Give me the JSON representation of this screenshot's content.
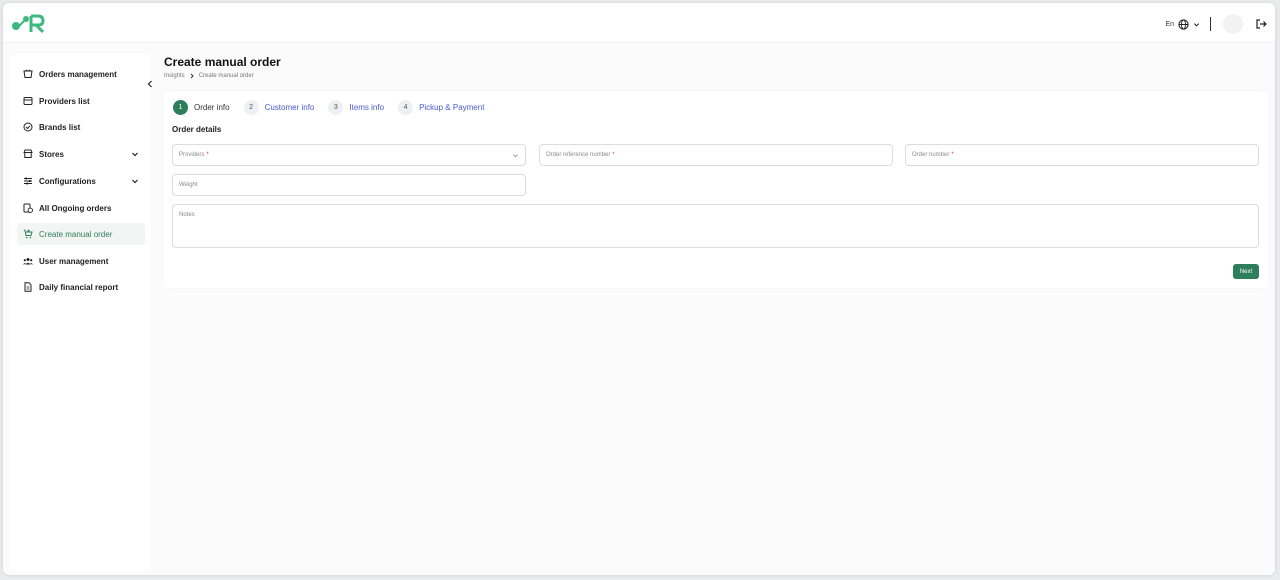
{
  "brand": {
    "accent": "#2e7d5b",
    "logo_color": "#3cb97f"
  },
  "header": {
    "language": "En",
    "icons": [
      "globe-icon",
      "chevron-down-icon",
      "logout-icon"
    ]
  },
  "sidebar": {
    "items": [
      {
        "label": "Orders management",
        "icon": "basket-icon",
        "has_submenu": false,
        "active": false
      },
      {
        "label": "Providers list",
        "icon": "store-icon",
        "has_submenu": false,
        "active": false
      },
      {
        "label": "Brands list",
        "icon": "badge-check-icon",
        "has_submenu": false,
        "active": false
      },
      {
        "label": "Stores",
        "icon": "shop-icon",
        "has_submenu": true,
        "active": false
      },
      {
        "label": "Configurations",
        "icon": "sliders-icon",
        "has_submenu": true,
        "active": false
      },
      {
        "label": "All Ongoing orders",
        "icon": "orders-clock-icon",
        "has_submenu": false,
        "active": false
      },
      {
        "label": "Create manual order",
        "icon": "cart-plus-icon",
        "has_submenu": false,
        "active": true
      },
      {
        "label": "User management",
        "icon": "users-icon",
        "has_submenu": false,
        "active": false
      },
      {
        "label": "Daily financial report",
        "icon": "document-icon",
        "has_submenu": false,
        "active": false
      }
    ]
  },
  "page": {
    "title": "Create manual order",
    "breadcrumb": [
      "Insights",
      "Create manual order"
    ]
  },
  "stepper": [
    {
      "num": "1",
      "label": "Order info",
      "active": true
    },
    {
      "num": "2",
      "label": "Customer info",
      "active": false
    },
    {
      "num": "3",
      "label": "Items info",
      "active": false
    },
    {
      "num": "4",
      "label": "Pickup & Payment",
      "active": false
    }
  ],
  "form": {
    "section_title": "Order details",
    "providers": {
      "placeholder": "Providers",
      "required_mark": "*",
      "value": ""
    },
    "order_reference": {
      "placeholder": "Order reference number",
      "required_mark": "*",
      "value": ""
    },
    "order_number": {
      "placeholder": "Order number",
      "required_mark": "*",
      "value": ""
    },
    "weight": {
      "placeholder": "Weight",
      "value": ""
    },
    "notes": {
      "placeholder": "Notes",
      "value": ""
    },
    "next_label": "Next"
  }
}
